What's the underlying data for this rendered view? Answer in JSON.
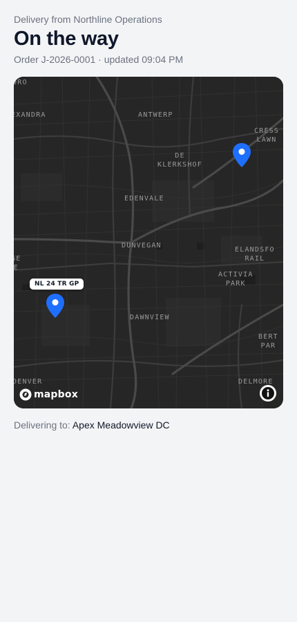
{
  "header": {
    "from": "Delivery from Northline Operations",
    "status_title": "On the way",
    "meta": "Order J-2026-0001 · updated 09:04 PM"
  },
  "map": {
    "attribution": "mapbox",
    "labels": {
      "oro": "ORO",
      "exandra": "EXANDRA",
      "antwerp": "ANTWERP",
      "cress_lawn": "CRESS\nLAWN",
      "de_klerkshof": "DE\nKLERKSHOF",
      "edenvale": "EDENVALE",
      "dunvegan": "DUNVEGAN",
      "elandsfontein": "ELANDSFO\nRAIL",
      "ge_e": "GE\nE",
      "activia_park": "ACTIVIA\nPARK",
      "dawnview": "DAWNVIEW",
      "bert_par": "BERT\nPAR",
      "denver": "DENVER",
      "delmore": "DELMORE"
    },
    "vehicle": {
      "plate": "NL 24 TR GP"
    },
    "icons": {
      "pin": "map-pin-icon",
      "info": "info-icon",
      "logo": "mapbox-logo-icon"
    },
    "colors": {
      "pin": "#1f6fff",
      "background": "#262626"
    }
  },
  "delivery": {
    "prefix": "Delivering to:",
    "destination": "Apex Meadowview DC"
  }
}
